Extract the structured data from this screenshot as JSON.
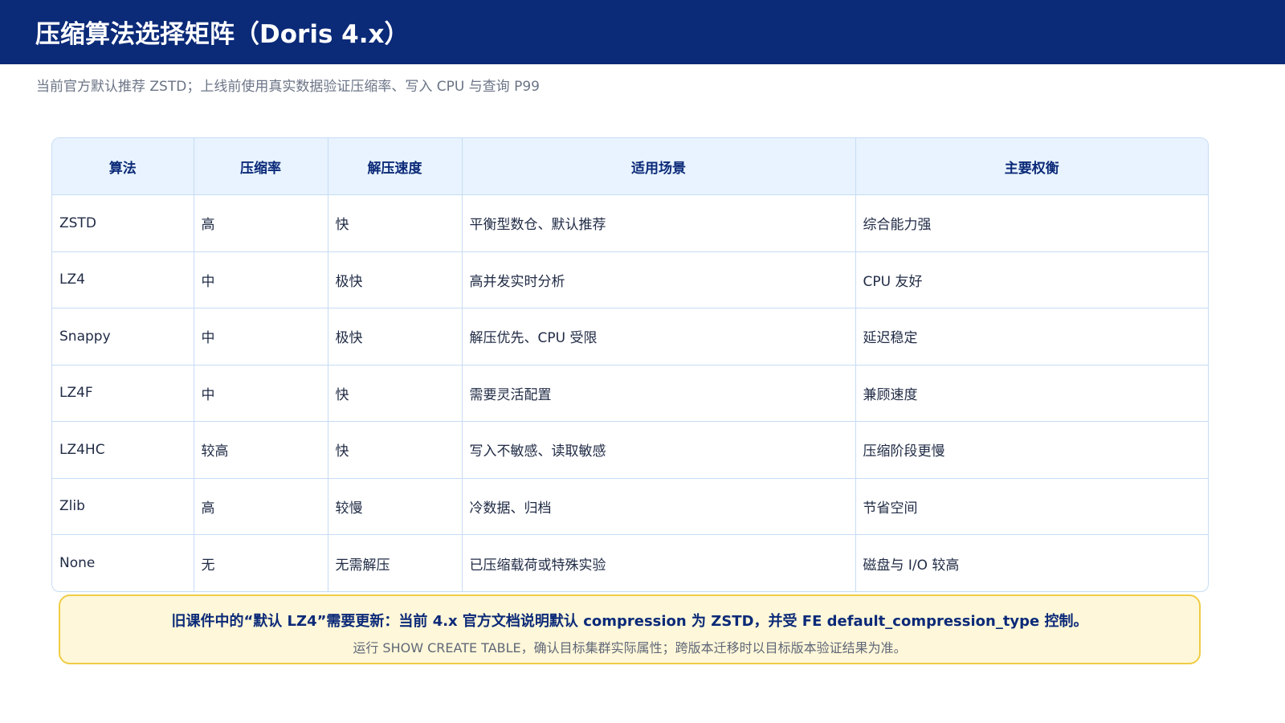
{
  "header": {
    "title": "压缩算法选择矩阵（Doris 4.x）",
    "subtitle": "当前官方默认推荐 ZSTD；上线前使用真实数据验证压缩率、写入 CPU 与查询 P99"
  },
  "table": {
    "columns": [
      "算法",
      "压缩率",
      "解压速度",
      "适用场景",
      "主要权衡"
    ],
    "rows": [
      [
        "ZSTD",
        "高",
        "快",
        "平衡型数仓、默认推荐",
        "综合能力强"
      ],
      [
        "LZ4",
        "中",
        "极快",
        "高并发实时分析",
        "CPU 友好"
      ],
      [
        "Snappy",
        "中",
        "极快",
        "解压优先、CPU 受限",
        "延迟稳定"
      ],
      [
        "LZ4F",
        "中",
        "快",
        "需要灵活配置",
        "兼顾速度"
      ],
      [
        "LZ4HC",
        "较高",
        "快",
        "写入不敏感、读取敏感",
        "压缩阶段更慢"
      ],
      [
        "Zlib",
        "高",
        "较慢",
        "冷数据、归档",
        "节省空间"
      ],
      [
        "None",
        "无",
        "无需解压",
        "已压缩载荷或特殊实验",
        "磁盘与 I/O 较高"
      ]
    ]
  },
  "note": {
    "main": "旧课件中的“默认 LZ4”需要更新：当前 4.x 官方文档说明默认 compression 为 ZSTD，并受 FE default_compression_type 控制。",
    "sub": "运行 SHOW CREATE TABLE，确认目标集群实际属性；跨版本迁移时以目标版本验证结果为准。"
  },
  "colors": {
    "header_bg": "#0b2a78",
    "table_header_bg": "#e8f3ff",
    "grid_line": "#c6dcf4",
    "note_bg": "#fff7d9",
    "note_border": "#efcc45"
  }
}
